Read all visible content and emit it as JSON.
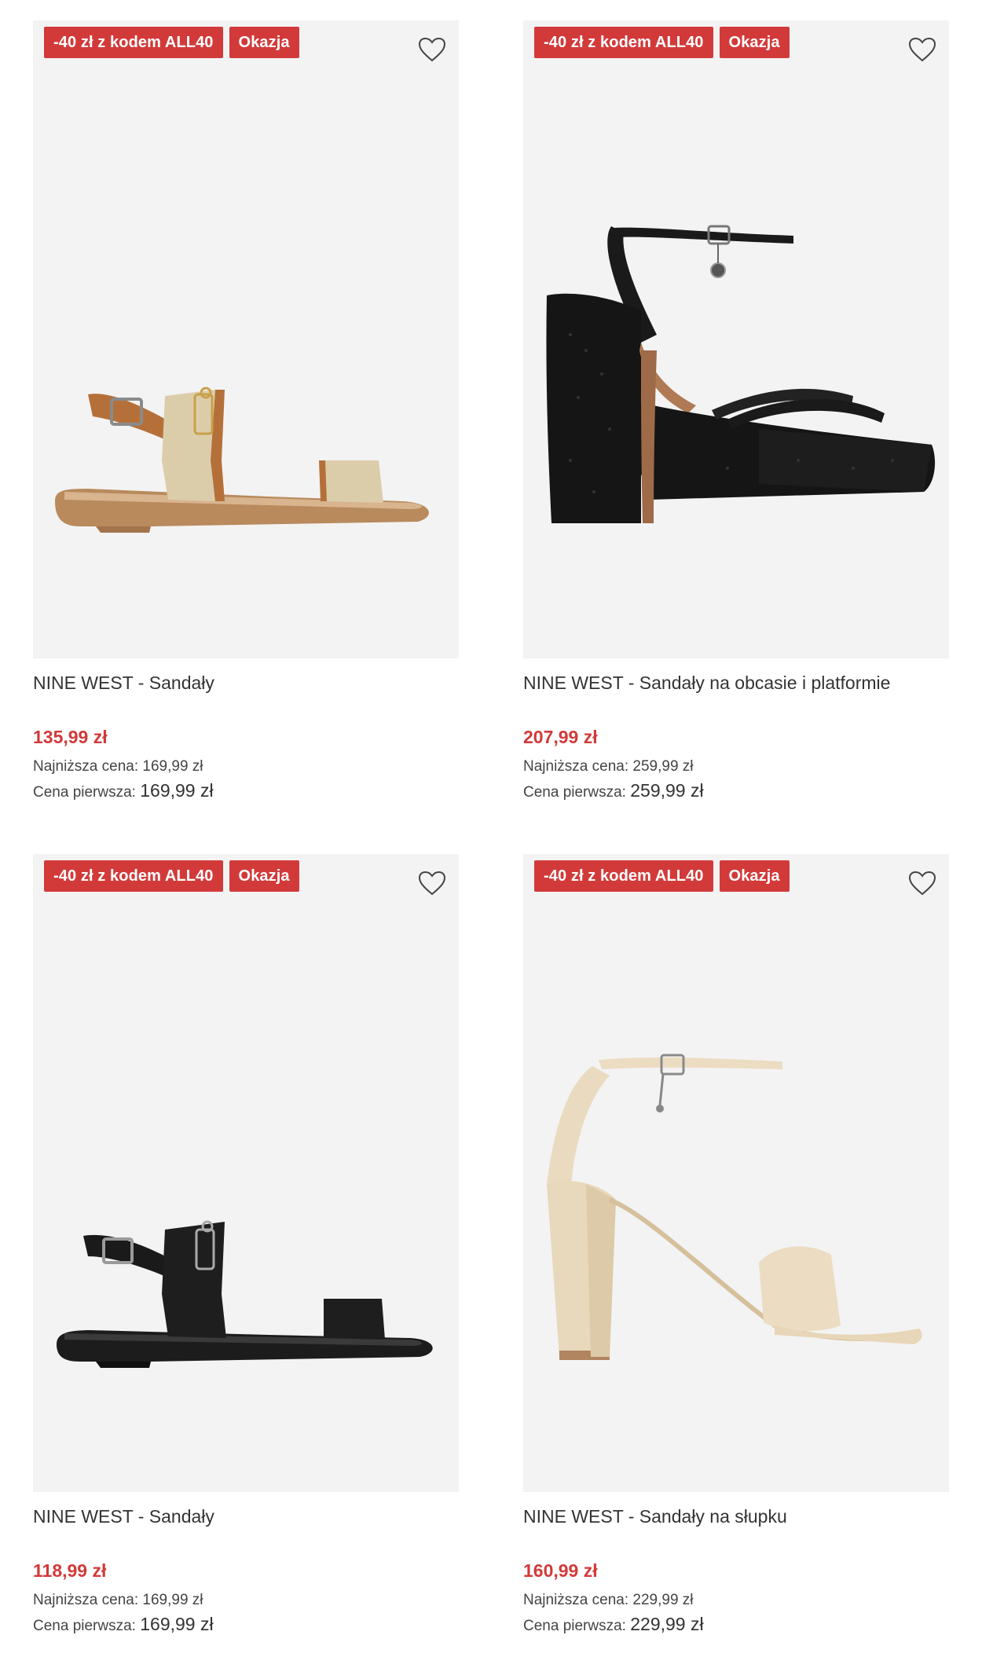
{
  "products": [
    {
      "badges": [
        "-40 zł z kodem ALL40",
        "Okazja"
      ],
      "title": "NINE WEST - Sandały",
      "price": "135,99 zł",
      "lowest_label": "Najniższa cena:",
      "lowest_value": "169,99 zł",
      "first_label": "Cena pierwsza:",
      "first_value": "169,99 zł",
      "image": "tan-beige-flat-sandal",
      "favorite_icon": "heart-outline-icon"
    },
    {
      "badges": [
        "-40 zł z kodem ALL40",
        "Okazja"
      ],
      "title": "NINE WEST - Sandały na obcasie i platformie",
      "price": "207,99 zł",
      "lowest_label": "Najniższa cena:",
      "lowest_value": "259,99 zł",
      "first_label": "Cena pierwsza:",
      "first_value": "259,99 zł",
      "image": "black-glitter-platform-heel-sandal",
      "favorite_icon": "heart-outline-icon"
    },
    {
      "badges": [
        "-40 zł z kodem ALL40",
        "Okazja"
      ],
      "title": "NINE WEST - Sandały",
      "price": "118,99 zł",
      "lowest_label": "Najniższa cena:",
      "lowest_value": "169,99 zł",
      "first_label": "Cena pierwsza:",
      "first_value": "169,99 zł",
      "image": "black-leather-flat-sandal",
      "favorite_icon": "heart-outline-icon"
    },
    {
      "badges": [
        "-40 zł z kodem ALL40",
        "Okazja"
      ],
      "title": "NINE WEST - Sandały na słupku",
      "price": "160,99 zł",
      "lowest_label": "Najniższa cena:",
      "lowest_value": "229,99 zł",
      "first_label": "Cena pierwsza:",
      "first_value": "229,99 zł",
      "image": "cream-croc-block-heel-sandal",
      "favorite_icon": "heart-outline-icon"
    }
  ],
  "colors": {
    "badge_bg": "#d23a3a",
    "price": "#d23a3a",
    "image_bg": "#f3f3f3"
  }
}
